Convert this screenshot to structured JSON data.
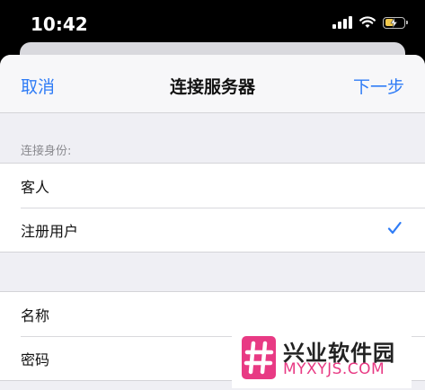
{
  "status_bar": {
    "time": "10:42",
    "battery_level": 0.45,
    "battery_color": "#f2c94c",
    "icons": [
      "signal-icon",
      "wifi-icon",
      "battery-charging-icon"
    ]
  },
  "nav": {
    "cancel_label": "取消",
    "title": "连接服务器",
    "next_label": "下一步"
  },
  "identity_section": {
    "header": "连接身份:",
    "options": [
      {
        "label": "客人",
        "selected": false
      },
      {
        "label": "注册用户",
        "selected": true
      }
    ]
  },
  "credentials": {
    "name_label": "名称",
    "password_label": "密码"
  },
  "watermark": {
    "name": "兴业软件园",
    "url": "MYXYJS.COM",
    "brand_color": "#e83a84"
  },
  "colors": {
    "accent": "#2f7cf6",
    "background": "#efeff4"
  }
}
